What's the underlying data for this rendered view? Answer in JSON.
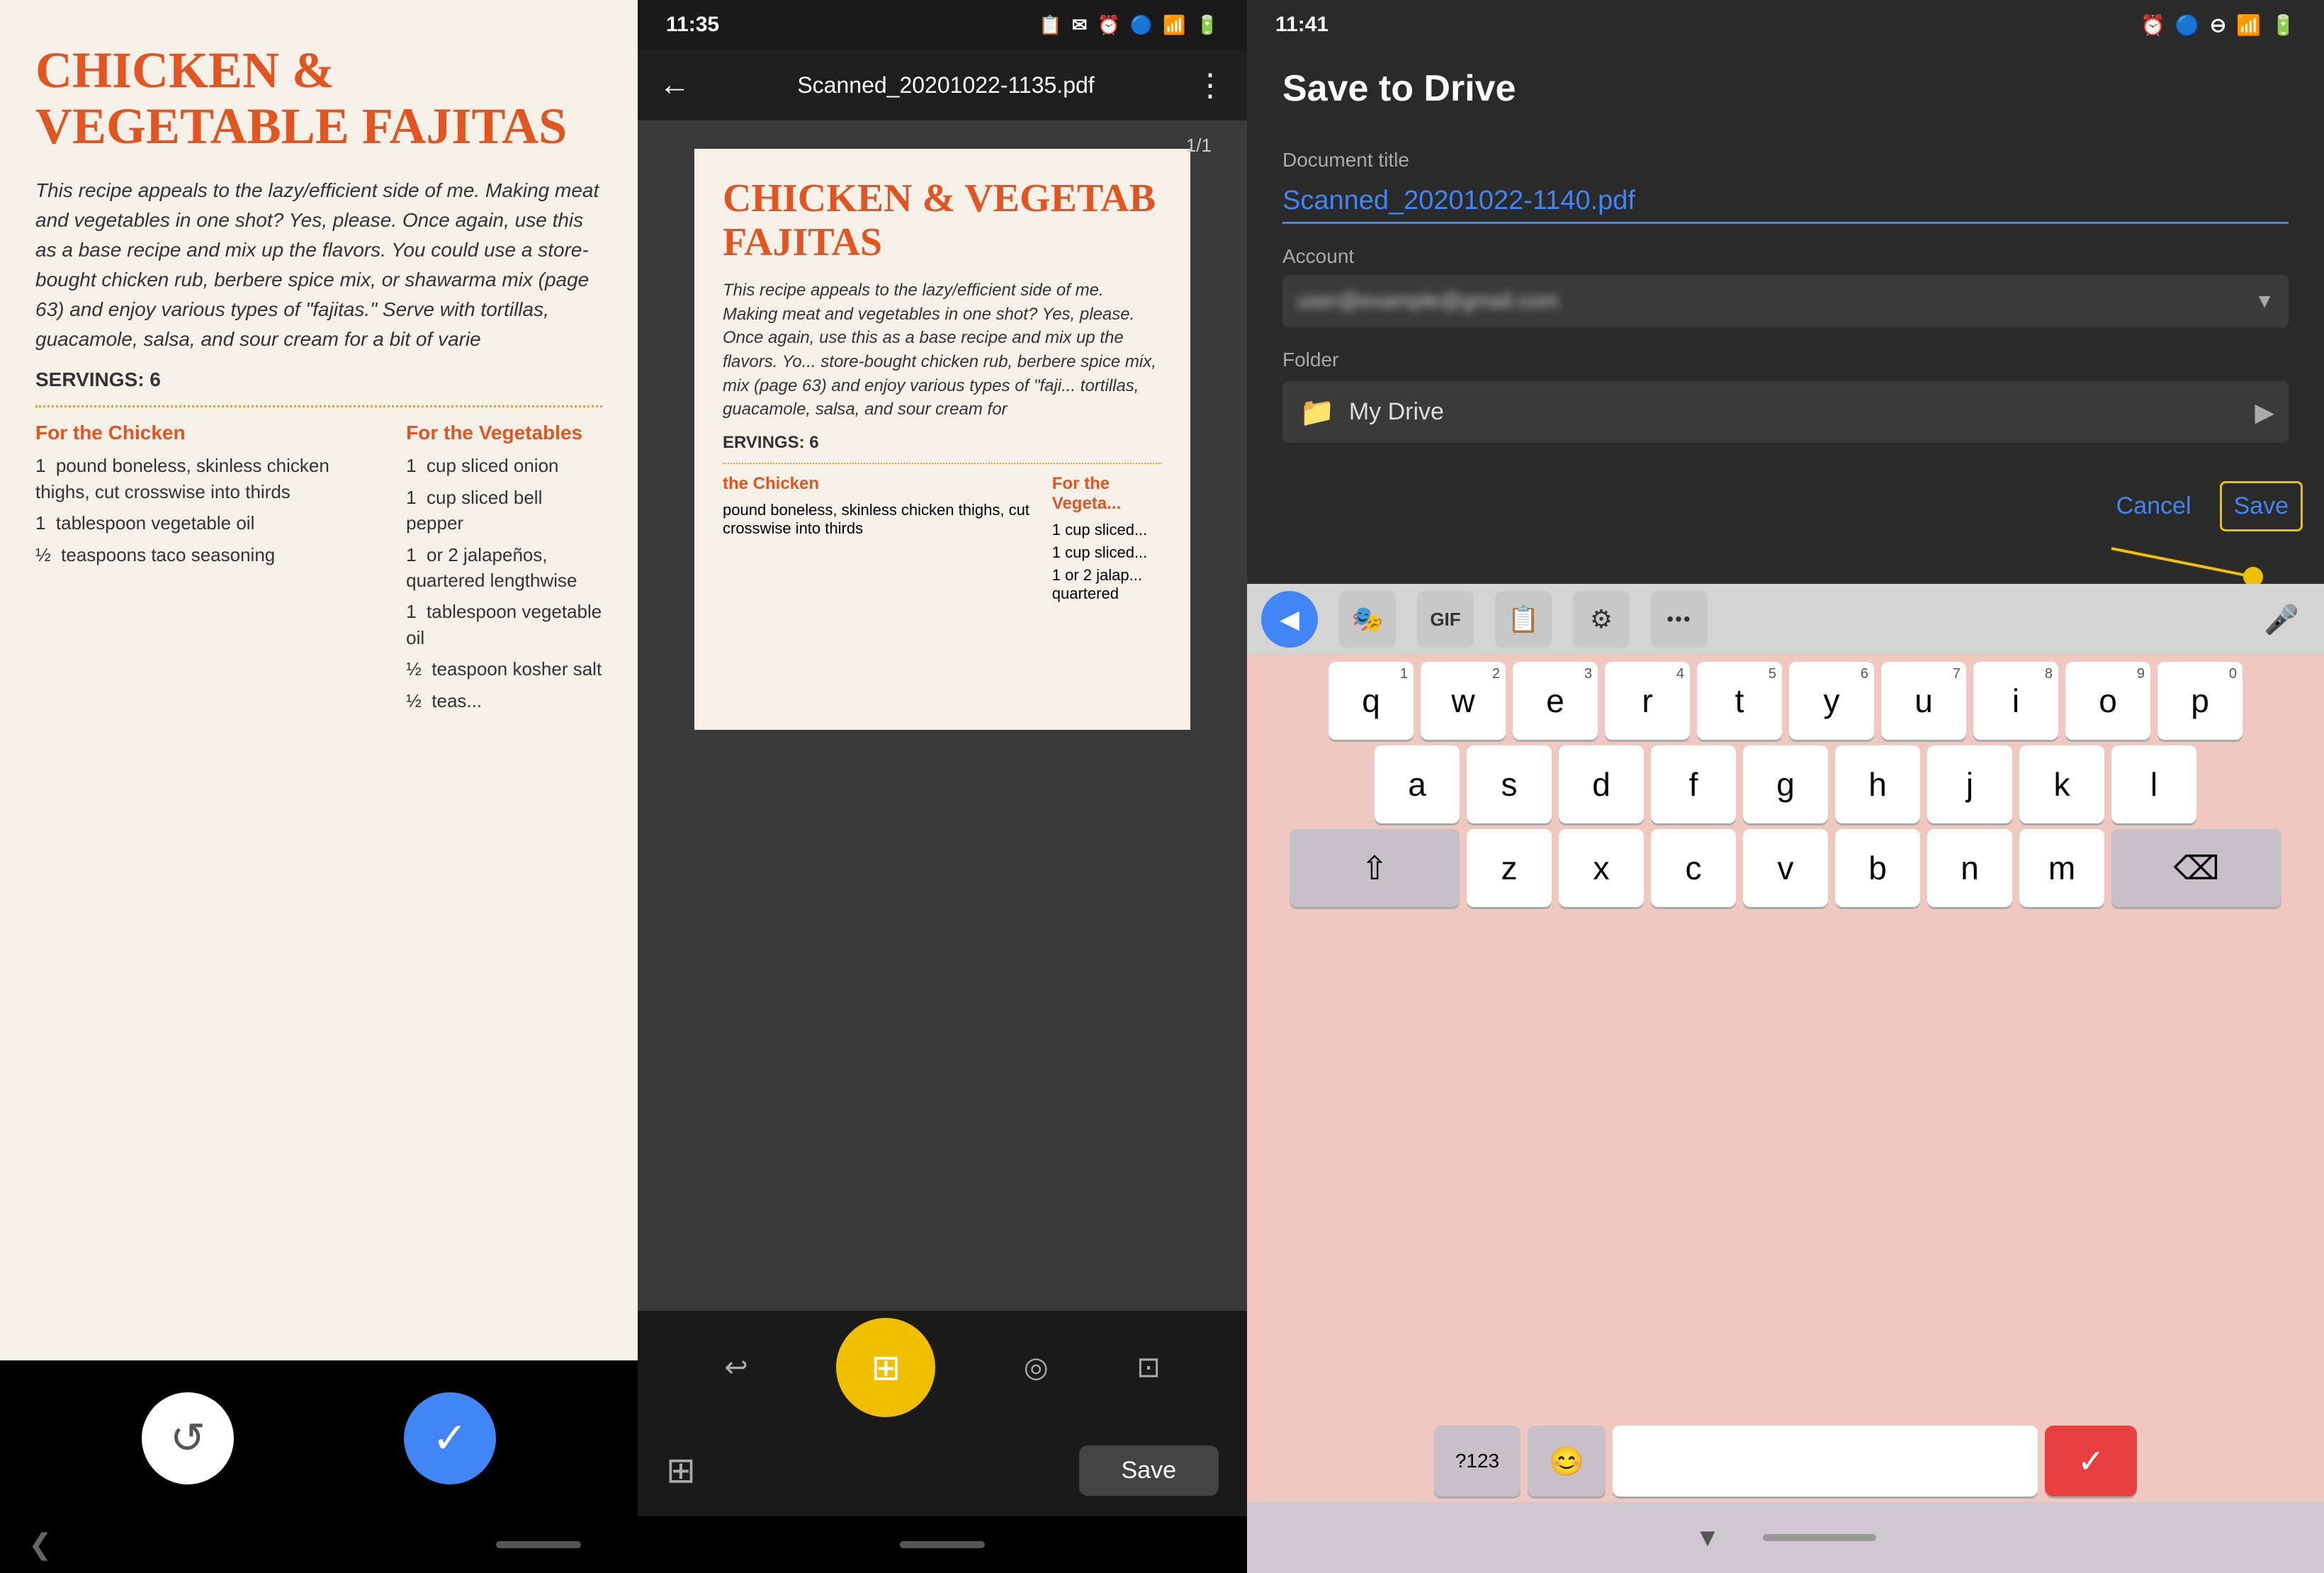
{
  "panel1": {
    "recipe": {
      "title": "CHICKEN & VEGETABLE FAJITAS",
      "intro": "This recipe appeals to the lazy/efficient side of me. Making meat and vegetables in one shot? Yes, please. Once again, use this as a base recipe and mix up the flavors. You could use a store-bought chicken rub, berbere spice mix, or shawarma mix (page 63) and enjoy various types of \"fajitas.\" Serve with tortillas, guacamole, salsa, and sour cream for a bit of varie",
      "servings": "SERVINGS: 6",
      "for_chicken": "For the Chicken",
      "for_vegetables": "For the Vegetables",
      "chicken_ingredients": [
        "1  pound boneless, skinless chicken thighs, cut crosswise into thirds",
        "1  tablespoon vegetable oil",
        "½  teaspoons taco seasoning"
      ],
      "vegetable_ingredients": [
        "1  cup sliced onion",
        "1  cup sliced bell pepper",
        "1  or 2 jalapeños, quartered lengthwise",
        "1  tablespoon vegetable oil",
        "½  teaspoon kosher salt",
        "½  teas..."
      ]
    },
    "bottom": {
      "undo_label": "↺",
      "check_label": "✓"
    }
  },
  "panel2": {
    "status_bar": {
      "time": "11:35",
      "icons": [
        "📋",
        "✉"
      ]
    },
    "toolbar": {
      "back_icon": "←",
      "title": "Scanned_20201022-1135.pdf",
      "more_icon": "⋮"
    },
    "page_indicator": "1/1",
    "tools": {
      "undo": "↩",
      "add_pages": "⊞",
      "erase": "◎",
      "crop": "⊡"
    },
    "save_button": "Save"
  },
  "panel3": {
    "status_bar": {
      "time": "11:41",
      "icons": [
        "⏰",
        "🔵",
        "⊖",
        "📶",
        "🔋"
      ]
    },
    "title": "Save to Drive",
    "form": {
      "document_title_label": "Document title",
      "document_title_value": "Scanned_20201022-1140.pdf",
      "account_label": "Account",
      "account_value": "••••••••@gmail.com",
      "folder_label": "Folder",
      "folder_name": "My Drive",
      "folder_icon": "📁"
    },
    "buttons": {
      "cancel": "Cancel",
      "save": "Save"
    },
    "keyboard": {
      "toolbar_items": [
        "←",
        "🎭",
        "GIF",
        "📋",
        "⚙",
        "···",
        "🎤"
      ],
      "number_row": [
        "1",
        "2",
        "3",
        "4",
        "5",
        "6",
        "7",
        "8",
        "9",
        "0"
      ],
      "row1": [
        "q",
        "w",
        "e",
        "r",
        "t",
        "y",
        "u",
        "i",
        "o",
        "p"
      ],
      "row2": [
        "a",
        "s",
        "d",
        "f",
        "g",
        "h",
        "j",
        "k",
        "l"
      ],
      "row3_left": "⇧",
      "row3_keys": [
        "z",
        "x",
        "c",
        "v",
        "b",
        "n",
        "m"
      ],
      "row3_right": "⌫",
      "bottom": {
        "special": "?123",
        "emoji": "😊",
        "space": "",
        "enter_icon": "✓"
      }
    }
  },
  "annotations": {
    "yellow_circle_color": "#f0c000",
    "save_box_label": "Save"
  }
}
